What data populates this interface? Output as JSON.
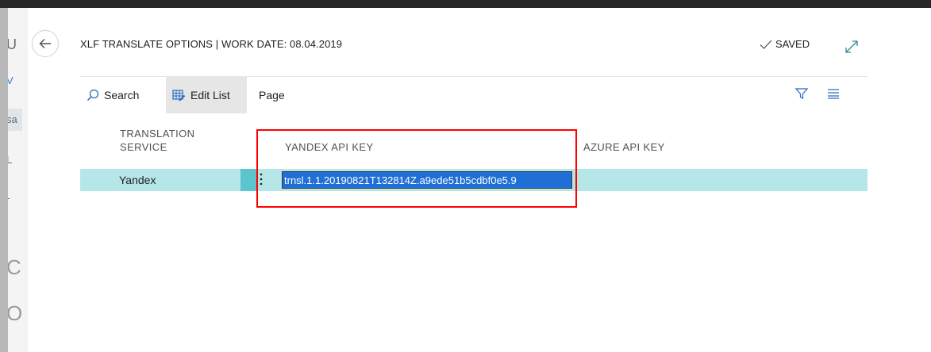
{
  "colors": {
    "row_highlight": "#b5e7e9",
    "row_selector": "#5bc4cc",
    "annotation": "#ff0000",
    "input_selection": "#1f6fd6"
  },
  "page": {
    "title": "XLF TRANSLATE OPTIONS | WORK DATE: 08.04.2019",
    "saved_label": "SAVED"
  },
  "actions": {
    "search_label": "Search",
    "edit_list_label": "Edit List",
    "page_label": "Page"
  },
  "table": {
    "columns": [
      "TRANSLATION\nSERVICE",
      "YANDEX API KEY",
      "AZURE API KEY"
    ],
    "rows": [
      {
        "translation_service": "Yandex",
        "yandex_api_key": "trnsl.1.1.20190821T132814Z.a9ede51b5cdbf0e5.9",
        "azure_api_key": ""
      }
    ]
  },
  "background_peek": [
    "U",
    "V",
    "sa",
    "L",
    "-",
    "C",
    "O"
  ]
}
